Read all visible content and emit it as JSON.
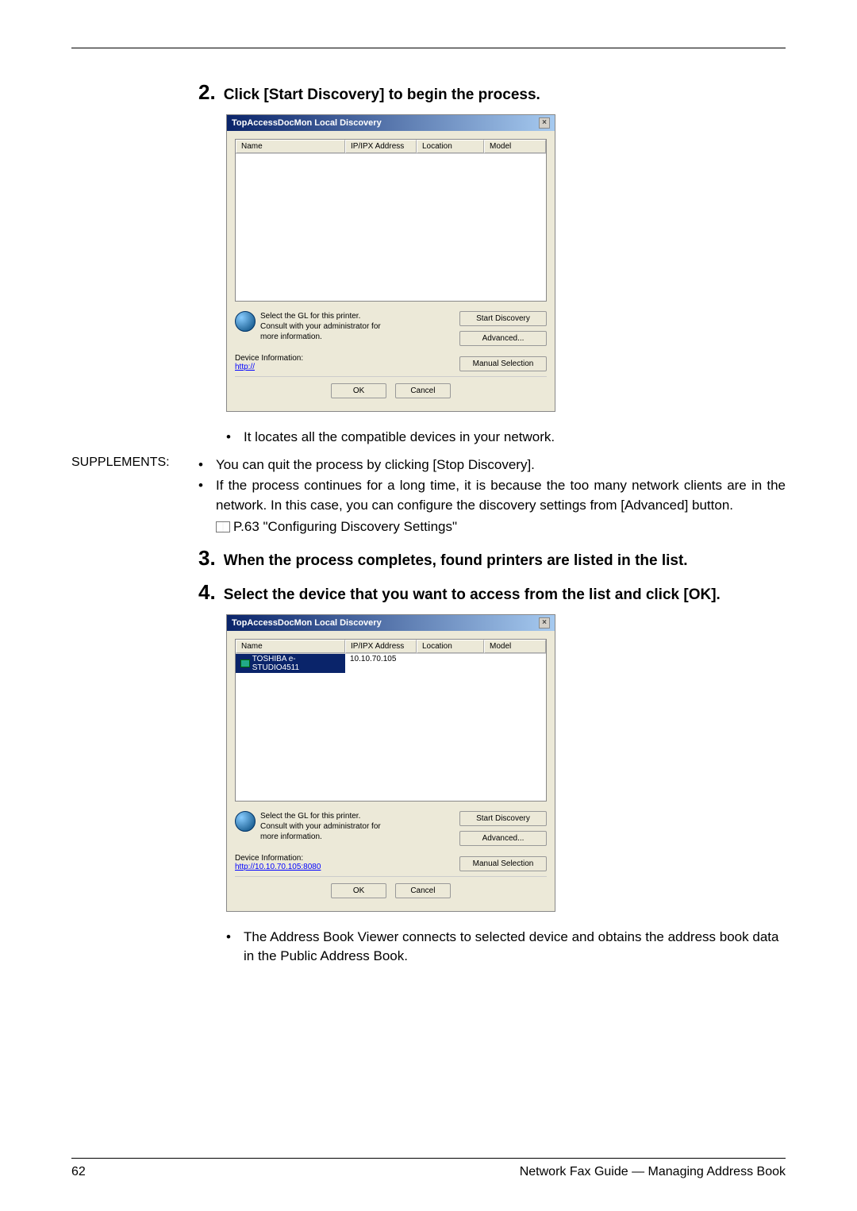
{
  "step2": {
    "num": "2.",
    "text": "Click [Start Discovery] to begin the process."
  },
  "dialog1": {
    "title": "TopAccessDocMon Local Discovery",
    "cols": {
      "name": "Name",
      "ip": "IP/IPX Address",
      "loc": "Location",
      "model": "Model"
    },
    "hint": "Select the GL for this printer. Consult with your administrator for more information.",
    "buttons": {
      "start": "Start Discovery",
      "advanced": "Advanced...",
      "manual": "Manual Selection"
    },
    "devinfo_label": "Device Information:",
    "devinfo_link": "http://",
    "ok": "OK",
    "cancel": "Cancel"
  },
  "bullet1": "It locates all the compatible devices in your network.",
  "supplements": {
    "label": "SUPPLEMENTS:",
    "item1": "You can quit the process by clicking [Stop Discovery].",
    "item2": "If the process continues for a long time, it is because the too many network clients are in the network.  In this case, you can configure the discovery settings from [Advanced] button."
  },
  "ref": "P.63 \"Configuring Discovery Settings\"",
  "step3": {
    "num": "3.",
    "text": "When the process completes, found printers are listed in the list."
  },
  "step4": {
    "num": "4.",
    "text": "Select the device that you want to access from the list and click [OK]."
  },
  "dialog2": {
    "title": "TopAccessDocMon Local Discovery",
    "cols": {
      "name": "Name",
      "ip": "IP/IPX Address",
      "loc": "Location",
      "model": "Model"
    },
    "row": {
      "name": "TOSHIBA e-STUDIO4511",
      "ip": "10.10.70.105"
    },
    "hint": "Select the GL for this printer. Consult with your administrator for more information.",
    "buttons": {
      "start": "Start Discovery",
      "advanced": "Advanced...",
      "manual": "Manual Selection"
    },
    "devinfo_label": "Device Information:",
    "devinfo_link": "http://10.10.70.105:8080",
    "ok": "OK",
    "cancel": "Cancel"
  },
  "bullet2": "The Address Book Viewer connects to selected device and obtains the address book data in the Public Address Book.",
  "footer": {
    "page": "62",
    "title": "Network Fax Guide — Managing Address Book"
  }
}
